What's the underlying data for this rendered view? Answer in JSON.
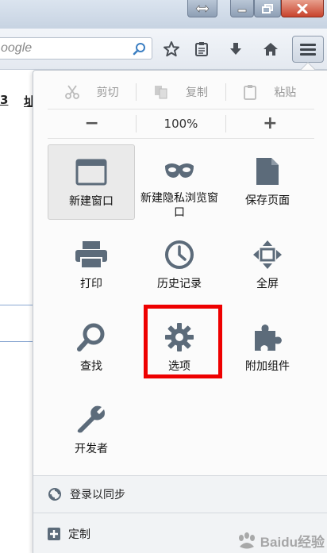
{
  "window": {
    "buttons": [
      "restore",
      "minimize",
      "maximize",
      "close"
    ]
  },
  "toolbar": {
    "search": {
      "placeholder": "oogle"
    },
    "icons": [
      "search-icon",
      "bookmark-star-icon",
      "reading-list-icon",
      "download-arrow-icon",
      "home-icon",
      "hamburger-menu-icon"
    ]
  },
  "page": {
    "links": [
      "3",
      "址"
    ]
  },
  "menu": {
    "edit": {
      "cut": "剪切",
      "copy": "复制",
      "paste": "粘贴"
    },
    "zoom": {
      "minus": "−",
      "level": "100%",
      "plus": "+"
    },
    "items": [
      {
        "label": "新建窗口",
        "icon": "new-window-icon"
      },
      {
        "label": "新建隐私浏览窗口",
        "icon": "private-mask-icon"
      },
      {
        "label": "保存页面",
        "icon": "save-page-icon"
      },
      {
        "label": "打印",
        "icon": "printer-icon"
      },
      {
        "label": "历史记录",
        "icon": "clock-icon"
      },
      {
        "label": "全屏",
        "icon": "fullscreen-icon"
      },
      {
        "label": "查找",
        "icon": "magnifier-icon"
      },
      {
        "label": "选项",
        "icon": "gear-icon"
      },
      {
        "label": "附加组件",
        "icon": "puzzle-piece-icon"
      },
      {
        "label": "开发者",
        "icon": "wrench-icon"
      }
    ],
    "sync": {
      "label": "登录以同步"
    },
    "customize": {
      "label": "定制"
    }
  },
  "watermark": {
    "text": "Baidu经验"
  },
  "colors": {
    "highlight": "#ee0000",
    "icon": "#5c6b7a"
  }
}
